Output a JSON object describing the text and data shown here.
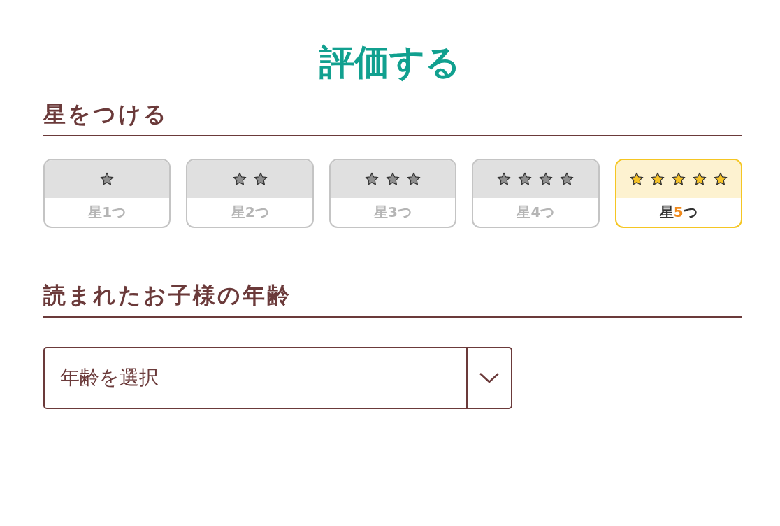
{
  "title": "評価する",
  "rating_section": {
    "heading": "星をつける",
    "options": [
      {
        "icons": [
          {
            "kind": "star"
          }
        ],
        "label": {
          "prefix": "星",
          "number": "1",
          "suffix": "つ"
        },
        "selected": false
      },
      {
        "icons": [
          {
            "kind": "star"
          },
          {
            "kind": "star"
          }
        ],
        "label": {
          "prefix": "星",
          "number": "2",
          "suffix": "つ"
        },
        "selected": false
      },
      {
        "icons": [
          {
            "kind": "star"
          },
          {
            "kind": "star"
          },
          {
            "kind": "star"
          }
        ],
        "label": {
          "prefix": "星",
          "number": "3",
          "suffix": "つ"
        },
        "selected": false
      },
      {
        "icons": [
          {
            "kind": "star"
          },
          {
            "kind": "star"
          },
          {
            "kind": "star"
          },
          {
            "kind": "star"
          }
        ],
        "label": {
          "prefix": "星",
          "number": "4",
          "suffix": "つ"
        },
        "selected": false
      },
      {
        "icons": [
          {
            "kind": "star"
          },
          {
            "kind": "star"
          },
          {
            "kind": "star"
          },
          {
            "kind": "star"
          },
          {
            "kind": "star"
          }
        ],
        "label": {
          "prefix": "星",
          "number": "5",
          "suffix": "つ"
        },
        "selected": true
      }
    ]
  },
  "age_section": {
    "heading": "読まれたお子様の年齢",
    "select": {
      "placeholder": "年齢を選択"
    }
  }
}
